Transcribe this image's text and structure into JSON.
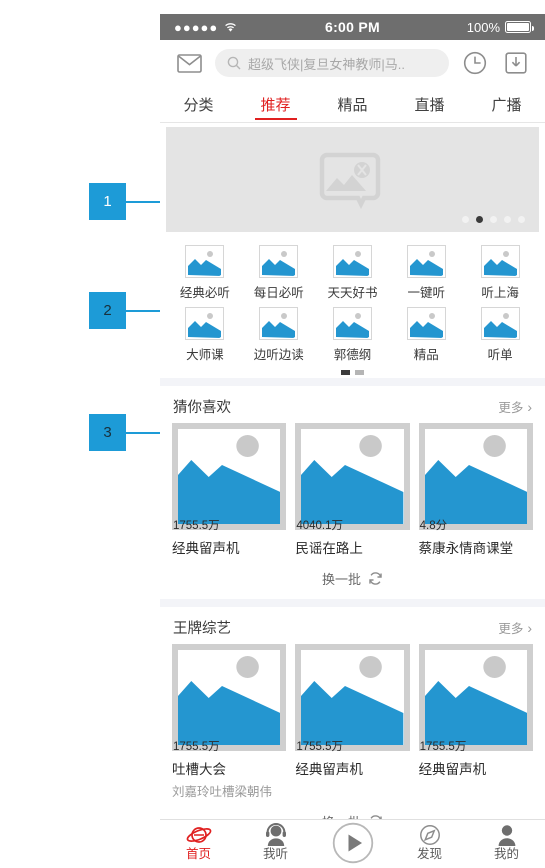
{
  "annotations": [
    {
      "number": "1",
      "target": "banner-carousel"
    },
    {
      "number": "2",
      "target": "icon-grid"
    },
    {
      "number": "3",
      "target": "recommend-sections"
    }
  ],
  "colors": {
    "accent_red": "#e02020",
    "accent_blue": "#1d9bd7",
    "placeholder_blue": "#2496d0",
    "statusbar_bg": "#6e6e6e",
    "page_bg": "#f3f4f8"
  },
  "statusbar": {
    "signal_dots": "●●●●●",
    "wifi_icon": "wifi-icon",
    "time": "6:00 PM",
    "battery_percent": "100%",
    "battery_icon": "battery-full-icon"
  },
  "header": {
    "mail_icon": "mail-icon",
    "search": {
      "icon": "search-icon",
      "placeholder": "超级飞侠|复旦女神教师|马..",
      "value": ""
    },
    "history_icon": "clock-history-icon",
    "download_icon": "download-icon"
  },
  "tabs": [
    {
      "label": "分类",
      "active": false
    },
    {
      "label": "推荐",
      "active": true
    },
    {
      "label": "精品",
      "active": false
    },
    {
      "label": "直播",
      "active": false
    },
    {
      "label": "广播",
      "active": false
    }
  ],
  "banner": {
    "placeholder_icon": "image-placeholder-icon",
    "dot_count": 5,
    "active_dot": 2
  },
  "icon_grid": {
    "rows": [
      [
        {
          "label": "经典必听"
        },
        {
          "label": "每日必听"
        },
        {
          "label": "天天好书"
        },
        {
          "label": "一键听"
        },
        {
          "label": "听上海"
        }
      ],
      [
        {
          "label": "大师课"
        },
        {
          "label": "边听边读"
        },
        {
          "label": "郭德纲"
        },
        {
          "label": "精品"
        },
        {
          "label": "听单"
        }
      ]
    ],
    "page_count": 2,
    "active_page": 1
  },
  "sections": [
    {
      "title": "猜你喜欢",
      "more_label": "更多",
      "more_chevron": "›",
      "cards": [
        {
          "count": "1755.5万",
          "title": "经典留声机",
          "subtitle": ""
        },
        {
          "count": "4040.1万",
          "title": "民谣在路上",
          "subtitle": ""
        },
        {
          "count": "4.8分",
          "title": "蔡康永情商课堂",
          "subtitle": ""
        }
      ],
      "refresh_label": "换一批",
      "refresh_icon": "refresh-icon"
    },
    {
      "title": "王牌综艺",
      "more_label": "更多",
      "more_chevron": "›",
      "cards": [
        {
          "count": "1755.5万",
          "title": "吐槽大会",
          "subtitle": "刘嘉玲吐槽梁朝伟"
        },
        {
          "count": "1755.5万",
          "title": "经典留声机",
          "subtitle": ""
        },
        {
          "count": "1755.5万",
          "title": "经典留声机",
          "subtitle": ""
        }
      ],
      "refresh_label": "换一批",
      "refresh_icon": "refresh-icon"
    }
  ],
  "tabbar": [
    {
      "label": "首页",
      "icon": "planet-home-icon",
      "active": true
    },
    {
      "label": "我听",
      "icon": "headphones-person-icon",
      "active": false
    },
    {
      "label": "",
      "icon": "play-circle-icon",
      "active": false
    },
    {
      "label": "发现",
      "icon": "compass-icon",
      "active": false
    },
    {
      "label": "我的",
      "icon": "person-icon",
      "active": false
    }
  ]
}
